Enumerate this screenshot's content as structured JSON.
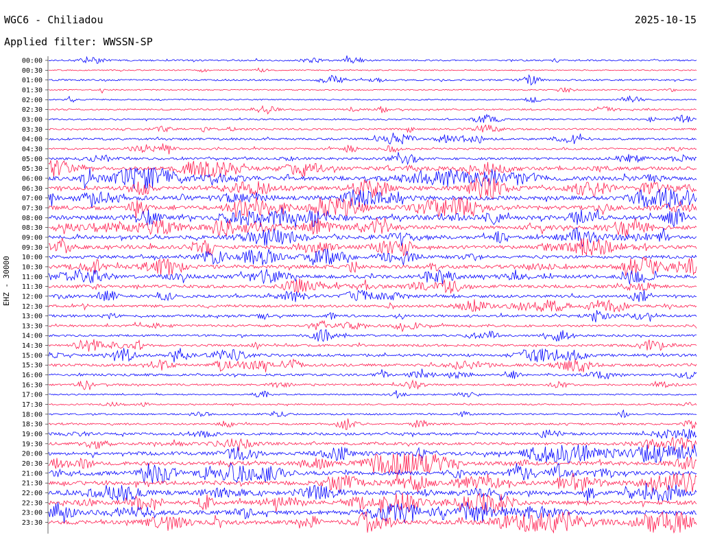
{
  "header": {
    "station": "WGC6 - Chiliadou",
    "date": "2025-10-15",
    "filter": "Applied filter: WWSSN-SP",
    "channel_label": "EHZ - 30000"
  },
  "chart_data": {
    "type": "line",
    "title": "WGC6 - Chiliadou",
    "subtitle": "Applied filter: WWSSN-SP",
    "ylabel": "EHZ - 30000",
    "grid": false,
    "series_colors": [
      "#0000ff",
      "#ff1a4d"
    ],
    "rows": [
      {
        "time": "00:00",
        "activity": 0.2
      },
      {
        "time": "00:30",
        "activity": 0.05
      },
      {
        "time": "01:00",
        "activity": 0.22
      },
      {
        "time": "01:30",
        "activity": 0.08
      },
      {
        "time": "02:00",
        "activity": 0.08
      },
      {
        "time": "02:30",
        "activity": 0.18
      },
      {
        "time": "03:00",
        "activity": 0.2
      },
      {
        "time": "03:30",
        "activity": 0.28
      },
      {
        "time": "04:00",
        "activity": 0.4
      },
      {
        "time": "04:30",
        "activity": 0.3
      },
      {
        "time": "05:00",
        "activity": 0.45
      },
      {
        "time": "05:30",
        "activity": 0.85
      },
      {
        "time": "06:00",
        "activity": 1.0
      },
      {
        "time": "06:30",
        "activity": 1.0
      },
      {
        "time": "07:00",
        "activity": 1.0
      },
      {
        "time": "07:30",
        "activity": 1.0
      },
      {
        "time": "08:00",
        "activity": 1.0
      },
      {
        "time": "08:30",
        "activity": 0.9
      },
      {
        "time": "09:00",
        "activity": 0.85
      },
      {
        "time": "09:30",
        "activity": 0.8
      },
      {
        "time": "10:00",
        "activity": 0.7
      },
      {
        "time": "10:30",
        "activity": 0.85
      },
      {
        "time": "11:00",
        "activity": 0.75
      },
      {
        "time": "11:30",
        "activity": 0.65
      },
      {
        "time": "12:00",
        "activity": 0.55
      },
      {
        "time": "12:30",
        "activity": 0.5
      },
      {
        "time": "13:00",
        "activity": 0.45
      },
      {
        "time": "13:30",
        "activity": 0.4
      },
      {
        "time": "14:00",
        "activity": 0.35
      },
      {
        "time": "14:30",
        "activity": 0.4
      },
      {
        "time": "15:00",
        "activity": 0.55
      },
      {
        "time": "15:30",
        "activity": 0.55
      },
      {
        "time": "16:00",
        "activity": 0.4
      },
      {
        "time": "16:30",
        "activity": 0.3
      },
      {
        "time": "17:00",
        "activity": 0.12
      },
      {
        "time": "17:30",
        "activity": 0.15
      },
      {
        "time": "18:00",
        "activity": 0.18
      },
      {
        "time": "18:30",
        "activity": 0.3
      },
      {
        "time": "19:00",
        "activity": 0.5
      },
      {
        "time": "19:30",
        "activity": 0.55
      },
      {
        "time": "20:00",
        "activity": 0.8
      },
      {
        "time": "20:30",
        "activity": 0.9
      },
      {
        "time": "21:00",
        "activity": 0.95
      },
      {
        "time": "21:30",
        "activity": 0.95
      },
      {
        "time": "22:00",
        "activity": 0.95
      },
      {
        "time": "22:30",
        "activity": 0.95
      },
      {
        "time": "23:00",
        "activity": 1.0
      },
      {
        "time": "23:30",
        "activity": 1.0
      }
    ]
  }
}
